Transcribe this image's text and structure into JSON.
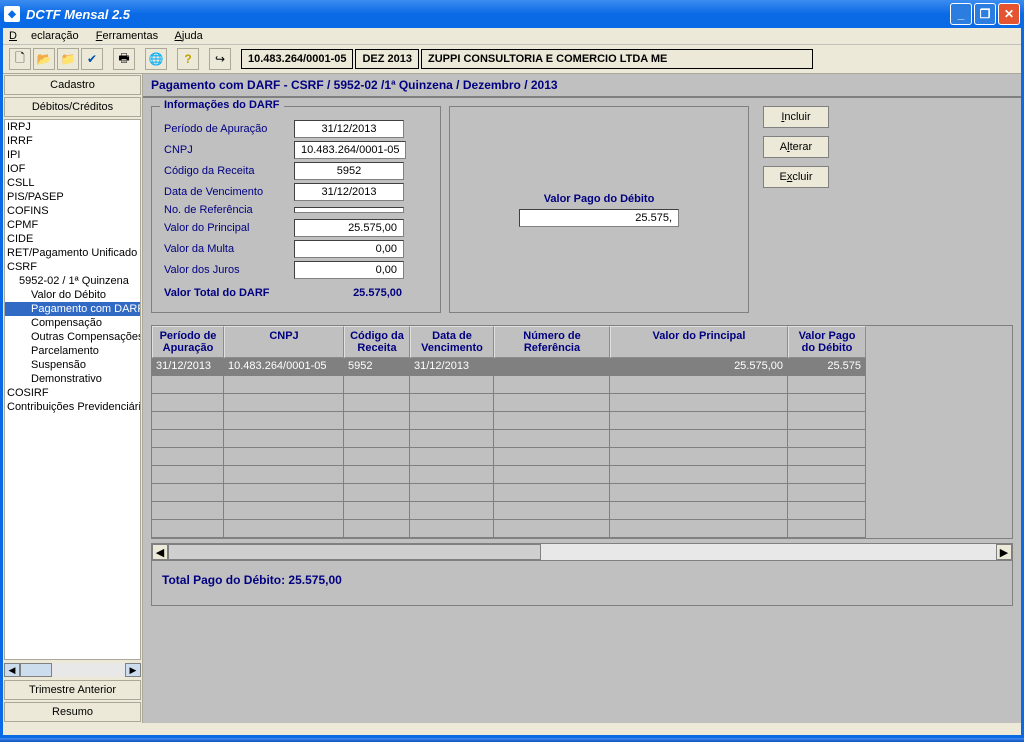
{
  "window": {
    "title": "DCTF Mensal 2.5"
  },
  "menu": {
    "declaracao": "Declaração",
    "ferramentas": "Ferramentas",
    "ajuda": "Ajuda"
  },
  "toolbar": {
    "cnpj": "10.483.264/0001-05",
    "periodo": "DEZ 2013",
    "empresa": "ZUPPI CONSULTORIA E COMERCIO LTDA ME"
  },
  "left": {
    "cadastro": "Cadastro",
    "debitos": "Débitos/Créditos",
    "trimestre": "Trimestre Anterior",
    "resumo": "Resumo",
    "tree": [
      {
        "t": "IRPJ",
        "i": 0
      },
      {
        "t": "IRRF",
        "i": 0
      },
      {
        "t": "IPI",
        "i": 0
      },
      {
        "t": "IOF",
        "i": 0
      },
      {
        "t": "CSLL",
        "i": 0
      },
      {
        "t": "PIS/PASEP",
        "i": 0
      },
      {
        "t": "COFINS",
        "i": 0
      },
      {
        "t": "CPMF",
        "i": 0
      },
      {
        "t": "CIDE",
        "i": 0
      },
      {
        "t": "RET/Pagamento Unificado",
        "i": 0
      },
      {
        "t": "CSRF",
        "i": 0
      },
      {
        "t": "5952-02 / 1ª Quinzena",
        "i": 1
      },
      {
        "t": "Valor do Débito",
        "i": 2
      },
      {
        "t": "Pagamento com DARF",
        "i": 2,
        "sel": true
      },
      {
        "t": "Compensação",
        "i": 2
      },
      {
        "t": "Outras Compensações",
        "i": 2
      },
      {
        "t": "Parcelamento",
        "i": 2
      },
      {
        "t": "Suspensão",
        "i": 2
      },
      {
        "t": "Demonstrativo",
        "i": 2
      },
      {
        "t": "COSIRF",
        "i": 0
      },
      {
        "t": "Contribuições Previdenciárias",
        "i": 0
      }
    ]
  },
  "header": "Pagamento com DARF - CSRF / 5952-02 /1ª Quinzena / Dezembro / 2013",
  "form": {
    "legend": "Informações do DARF",
    "periodo_l": "Período de Apuração",
    "periodo_v": "31/12/2013",
    "cnpj_l": "CNPJ",
    "cnpj_v": "10.483.264/0001-05",
    "cod_l": "Código da Receita",
    "cod_v": "5952",
    "venc_l": "Data de Vencimento",
    "venc_v": "31/12/2013",
    "ref_l": "No. de Referência",
    "ref_v": "",
    "princ_l": "Valor do Principal",
    "princ_v": "25.575,00",
    "multa_l": "Valor da Multa",
    "multa_v": "0,00",
    "juros_l": "Valor dos Juros",
    "juros_v": "0,00",
    "total_l": "Valor Total do DARF",
    "total_v": "25.575,00"
  },
  "rightbox": {
    "label": "Valor Pago do Débito",
    "value": "25.575,"
  },
  "actions": {
    "incluir": "Incluir",
    "alterar": "Alterar",
    "excluir": "Excluir"
  },
  "grid": {
    "headers": {
      "per": "Período de Apuração",
      "cnpj": "CNPJ",
      "cod": "Código da Receita",
      "venc": "Data de Vencimento",
      "num": "Número de Referência",
      "vp": "Valor do Principal",
      "vpd": "Valor Pago do Débito"
    },
    "row": {
      "per": "31/12/2013",
      "cnpj": "10.483.264/0001-05",
      "cod": "5952",
      "venc": "31/12/2013",
      "num": "",
      "vp": "25.575,00",
      "vpd": "25.575"
    }
  },
  "total_line": "Total Pago do Débito:  25.575,00"
}
